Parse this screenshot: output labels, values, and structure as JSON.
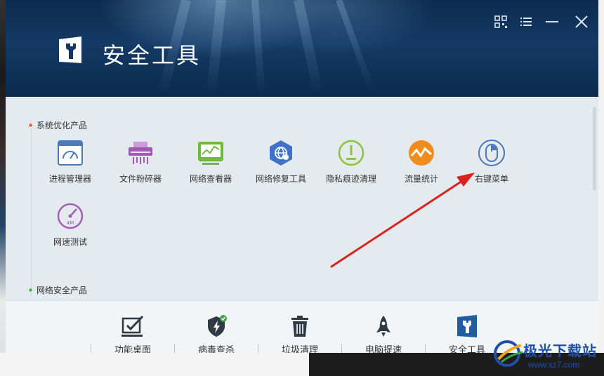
{
  "window": {
    "title": "安全工具"
  },
  "titlebar": {
    "buttons": [
      "qr-code-icon",
      "menu-icon",
      "minimize-icon",
      "close-icon"
    ]
  },
  "sections": [
    {
      "label": "系统优化产品",
      "dot_color": "#e8674b",
      "tools": [
        {
          "label": "进程管理器",
          "icon": "process-manager-icon",
          "color": "#4a7bb8"
        },
        {
          "label": "文件粉碎器",
          "icon": "file-shredder-icon",
          "color": "#a15bb7"
        },
        {
          "label": "网络查看器",
          "icon": "network-viewer-icon",
          "color": "#6fb93c"
        },
        {
          "label": "网络修复工具",
          "icon": "network-repair-icon",
          "color": "#3d73c9"
        },
        {
          "label": "隐私痕迹清理",
          "icon": "privacy-cleaner-icon",
          "color": "#8cc23d"
        },
        {
          "label": "流量统计",
          "icon": "traffic-stats-icon",
          "color": "#f08c1c"
        },
        {
          "label": "右键菜单",
          "icon": "right-click-menu-icon",
          "color": "#4a78b8"
        },
        {
          "label": "网速测试",
          "icon": "speed-test-icon",
          "color": "#a35fb6"
        }
      ]
    },
    {
      "label": "网络安全产品",
      "dot_color": "#5bb75b",
      "tools": []
    }
  ],
  "bottom_nav": [
    {
      "label": "功能桌面",
      "icon": "desktop-check-icon"
    },
    {
      "label": "病毒查杀",
      "icon": "shield-virus-icon"
    },
    {
      "label": "垃圾清理",
      "icon": "trash-icon"
    },
    {
      "label": "电脑提速",
      "icon": "rocket-icon"
    },
    {
      "label": "安全工具",
      "icon": "security-tools-icon",
      "active": true
    }
  ],
  "watermark": {
    "text": "极光下载站",
    "url": "www.xz7.com"
  },
  "annotation": {
    "arrow_color": "#d8231f"
  }
}
